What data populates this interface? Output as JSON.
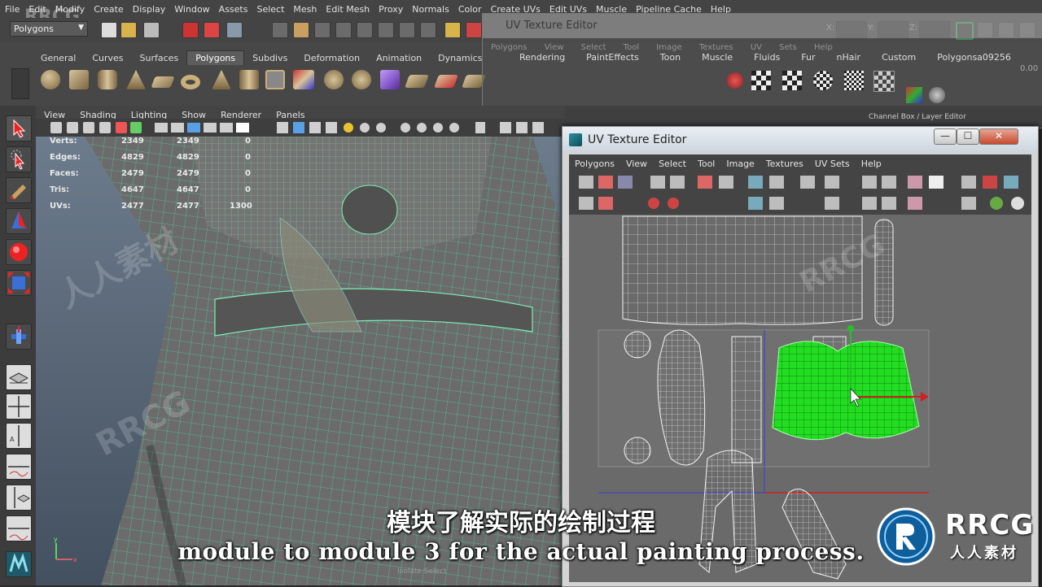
{
  "menubar": {
    "watermark": "RRCG",
    "items": [
      "File",
      "Edit",
      "Modify",
      "Create",
      "Display",
      "Window",
      "Assets",
      "Select",
      "Mesh",
      "Edit Mesh",
      "Proxy",
      "Normals",
      "Color",
      "Create UVs",
      "Edit UVs",
      "Muscle",
      "Pipeline Cache",
      "Help"
    ]
  },
  "statusline": {
    "mode": "Polygons",
    "x_label": "X:",
    "y_label": "Y:",
    "z_label": "Z:"
  },
  "shelf": {
    "tabs": [
      "General",
      "Curves",
      "Surfaces",
      "Polygons",
      "Subdivs",
      "Deformation",
      "Animation",
      "Dynamics"
    ],
    "active_tab": "Polygons"
  },
  "bg_editor": {
    "title": "UV Texture Editor",
    "menu": [
      "Polygons",
      "View",
      "Select",
      "Tool",
      "Image",
      "Textures",
      "UV Sets",
      "Help"
    ],
    "shelf_tabs": [
      "Rendering",
      "PaintEffects",
      "Toon",
      "Muscle",
      "Fluids",
      "Fur",
      "nHair",
      "Custom",
      "Polygonsa09256"
    ],
    "channel_box": "Channel Box / Layer Editor",
    "value": "0.00"
  },
  "viewport": {
    "menu": [
      "View",
      "Shading",
      "Lighting",
      "Show",
      "Renderer",
      "Panels"
    ],
    "hud": [
      {
        "label": "Verts:",
        "a": "2349",
        "b": "2349",
        "c": "0"
      },
      {
        "label": "Edges:",
        "a": "4829",
        "b": "4829",
        "c": "0"
      },
      {
        "label": "Faces:",
        "a": "2479",
        "b": "2479",
        "c": "0"
      },
      {
        "label": "Tris:",
        "a": "4647",
        "b": "4647",
        "c": "0"
      },
      {
        "label": "UVs:",
        "a": "2477",
        "b": "2477",
        "c": "1300"
      }
    ],
    "isolate": "Isolate Select"
  },
  "uv_editor": {
    "title": "UV Texture Editor",
    "minimize": "—",
    "maximize": "☐",
    "close": "✕",
    "menu": [
      "Polygons",
      "View",
      "Select",
      "Tool",
      "Image",
      "Textures",
      "UV Sets",
      "Help"
    ]
  },
  "subtitle": {
    "cn": "模块了解实际的绘制过程",
    "en": "module to module 3 for the actual painting process."
  },
  "logo": {
    "brand": "RRCG",
    "cn": "人人素材"
  },
  "colors": {
    "uv_selected": "#22dd22",
    "wire_green": "#3ef08a",
    "accent_red": "#d42020"
  }
}
